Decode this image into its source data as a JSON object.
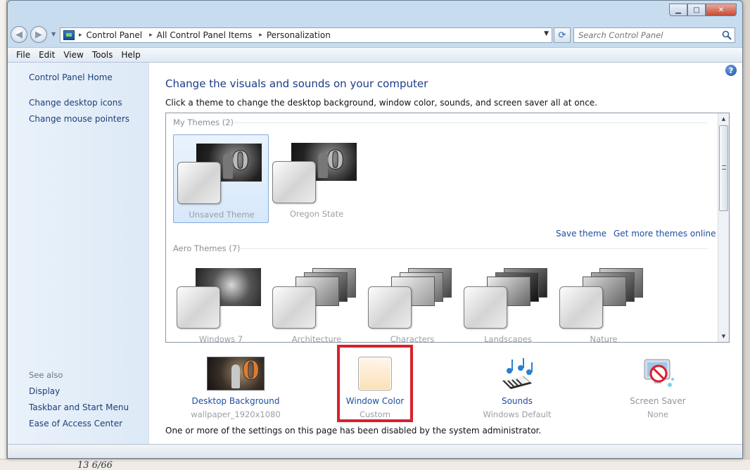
{
  "window": {
    "minimize_glyph": "▁",
    "maximize_glyph": "□",
    "close_glyph": "✕"
  },
  "nav": {
    "back_glyph": "◀",
    "forward_glyph": "▶",
    "dropdown_glyph": "▼",
    "refresh_glyph": "⟳"
  },
  "address": {
    "crumbs": [
      "Control Panel",
      "All Control Panel Items",
      "Personalization"
    ],
    "separator": "▸"
  },
  "search": {
    "placeholder": "Search Control Panel"
  },
  "menu": [
    "File",
    "Edit",
    "View",
    "Tools",
    "Help"
  ],
  "sidebar": {
    "home": "Control Panel Home",
    "tasks": [
      "Change desktop icons",
      "Change mouse pointers"
    ],
    "see_also_heading": "See also",
    "see_also": [
      "Display",
      "Taskbar and Start Menu",
      "Ease of Access Center"
    ]
  },
  "help_glyph": "?",
  "main": {
    "title": "Change the visuals and sounds on your computer",
    "subtitle": "Click a theme to change the desktop background, window color, sounds, and screen saver all at once."
  },
  "themes": {
    "my_themes_label": "My Themes (2)",
    "my_themes": [
      "Unsaved Theme",
      "Oregon State"
    ],
    "save_theme": "Save theme",
    "get_more": "Get more themes online",
    "aero_label": "Aero Themes (7)",
    "aero_themes": [
      "Windows 7",
      "Architecture",
      "Characters",
      "Landscapes",
      "Nature"
    ]
  },
  "settings": {
    "background": {
      "label": "Desktop Background",
      "value": "wallpaper_1920x1080"
    },
    "color": {
      "label": "Window Color",
      "value": "Custom"
    },
    "sounds": {
      "label": "Sounds",
      "value": "Windows Default"
    },
    "screensaver": {
      "label": "Screen Saver",
      "value": "None"
    }
  },
  "notice": "One or more of the settings on this page has been disabled by the system administrator.",
  "colors": {
    "link": "#1c4fa0",
    "title": "#1e3a8a",
    "highlight": "#d9202a",
    "sidebar": "#e3eef9"
  },
  "background_text": "13 6/66"
}
